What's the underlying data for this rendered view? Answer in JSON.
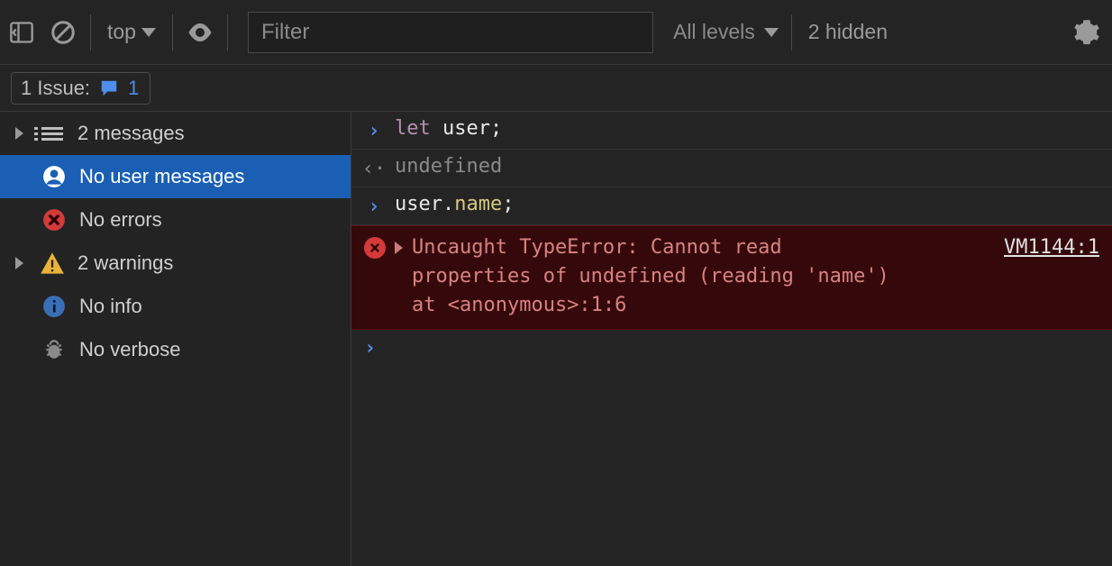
{
  "toolbar": {
    "context_label": "top",
    "filter_placeholder": "Filter",
    "levels_label": "All levels",
    "hidden_label": "2 hidden"
  },
  "issues": {
    "label": "1 Issue:",
    "count": "1"
  },
  "sidebar": {
    "messages": {
      "label": "2 messages"
    },
    "user_messages": {
      "label": "No user messages"
    },
    "errors": {
      "label": "No errors"
    },
    "warnings": {
      "label": "2 warnings"
    },
    "info": {
      "label": "No info"
    },
    "verbose": {
      "label": "No verbose"
    }
  },
  "console": {
    "line1_kw": "let",
    "line1_rest": " user;",
    "result1": "undefined",
    "line2_obj": "user",
    "line2_dot": ".",
    "line2_prop": "name",
    "line2_semi": ";",
    "error": {
      "msg_l1": "Uncaught TypeError: Cannot read",
      "msg_l2": "properties of undefined (reading 'name')",
      "msg_l3": "    at <anonymous>:1:6",
      "source": "VM1144:1"
    }
  }
}
